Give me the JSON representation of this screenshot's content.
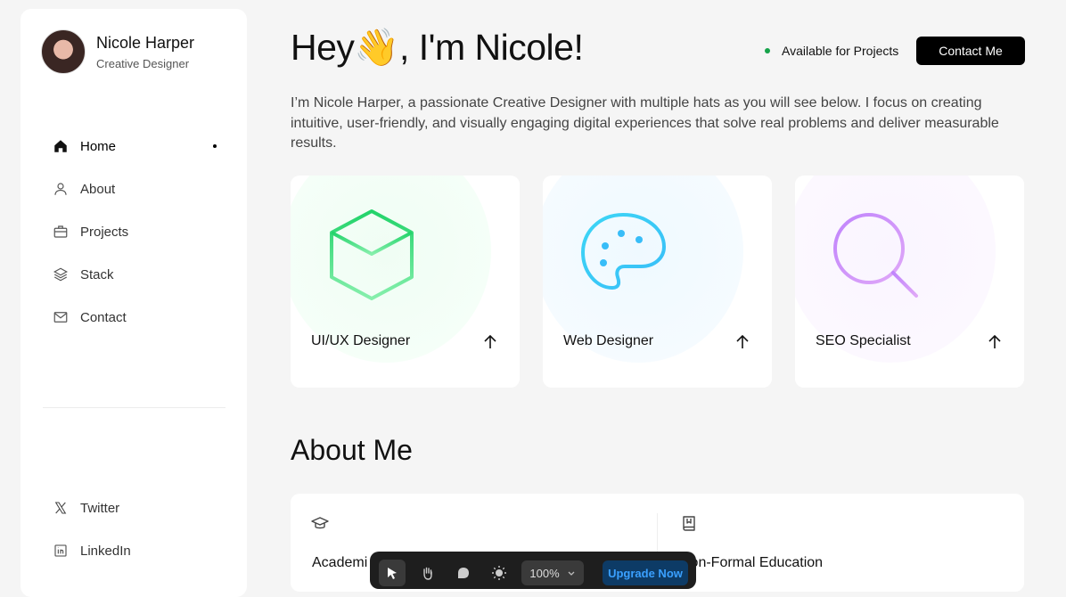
{
  "profile": {
    "name": "Nicole Harper",
    "role": "Creative Designer"
  },
  "nav": [
    {
      "label": "Home",
      "icon": "home-icon",
      "active": true
    },
    {
      "label": "About",
      "icon": "user-icon"
    },
    {
      "label": "Projects",
      "icon": "briefcase-icon"
    },
    {
      "label": "Stack",
      "icon": "layers-icon"
    },
    {
      "label": "Contact",
      "icon": "mail-icon"
    }
  ],
  "social": [
    {
      "label": "Twitter",
      "icon": "x-icon"
    },
    {
      "label": "LinkedIn",
      "icon": "linkedin-icon"
    }
  ],
  "hero": {
    "greeting_a": "Hey",
    "greeting_b": ", I'm Nicole!",
    "emoji": "👋",
    "intro": "I’m Nicole Harper, a passionate Creative Designer with multiple hats as you will see below. I focus on creating intuitive, user-friendly, and visually engaging digital experiences that solve real problems and deliver measurable results."
  },
  "status": {
    "label": "Available for Projects",
    "color": "#16a34a"
  },
  "contact_button": "Contact Me",
  "services": [
    {
      "label": "UI/UX Designer",
      "icon": "cube-icon",
      "color": "#3ddc84"
    },
    {
      "label": "Web Designer",
      "icon": "palette-icon",
      "color": "#38bdf8"
    },
    {
      "label": "SEO Specialist",
      "icon": "magnifier-icon",
      "color": "#c084fc"
    }
  ],
  "about": {
    "title": "About Me",
    "columns": [
      {
        "title": "Academi",
        "icon": "graduation-cap-icon"
      },
      {
        "title": "Non-Formal Education",
        "icon": "book-icon"
      }
    ]
  },
  "toolbar": {
    "zoom": "100%",
    "upgrade": "Upgrade Now"
  }
}
